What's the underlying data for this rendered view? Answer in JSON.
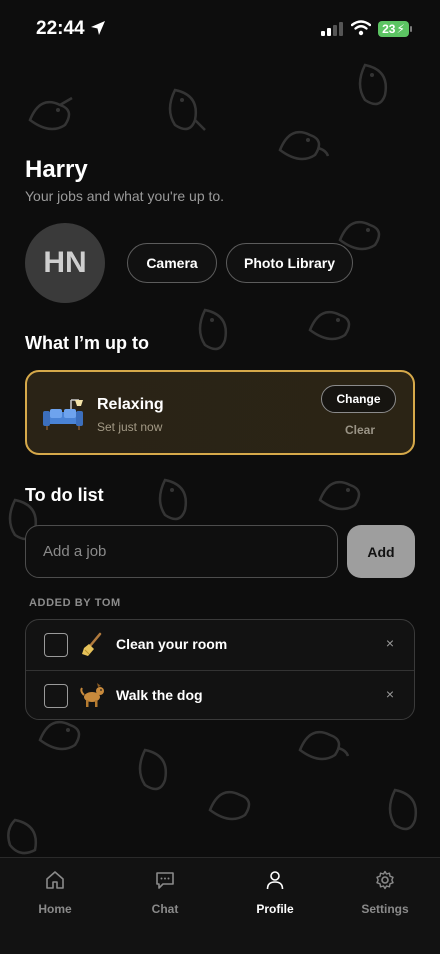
{
  "status_bar": {
    "time": "22:44",
    "battery": "23"
  },
  "profile": {
    "name": "Harry",
    "subtitle": "Your jobs and what you're up to.",
    "avatar_initials": "HN",
    "camera_label": "Camera",
    "library_label": "Photo Library"
  },
  "status_section": {
    "title": "What I’m up to",
    "card": {
      "emoji": "couch-and-lamp",
      "title": "Relaxing",
      "subtitle": "Set just now",
      "change_label": "Change",
      "clear_label": "Clear",
      "accent": "#d6a94a"
    }
  },
  "todo_section": {
    "title": "To do list",
    "input_placeholder": "Add a job",
    "add_label": "Add",
    "group_label": "ADDED BY TOM",
    "items": [
      {
        "emoji": "broom",
        "text": "Clean your room",
        "checked": false,
        "remove": "×"
      },
      {
        "emoji": "dog",
        "text": "Walk the dog",
        "checked": false,
        "remove": "×"
      }
    ]
  },
  "tab_bar": {
    "tabs": [
      {
        "label": "Home",
        "icon": "home-icon",
        "active": false
      },
      {
        "label": "Chat",
        "icon": "chat-icon",
        "active": false
      },
      {
        "label": "Profile",
        "icon": "person-icon",
        "active": true
      },
      {
        "label": "Settings",
        "icon": "gear-icon",
        "active": false
      }
    ]
  }
}
